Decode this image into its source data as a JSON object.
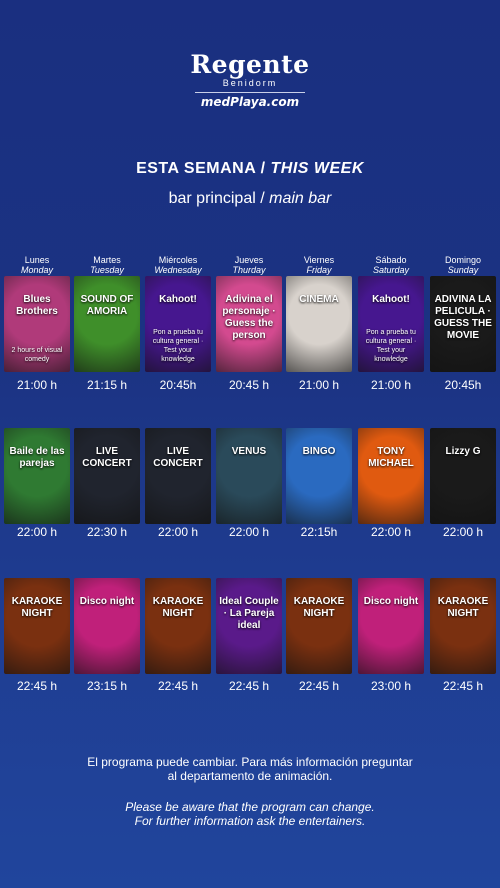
{
  "brand": {
    "name": "Regente",
    "city": "Benidorm",
    "group": "medPlaya.com"
  },
  "heading": {
    "es": "ESTA SEMANA",
    "separator": "/",
    "en": "THIS WEEK"
  },
  "subheading": {
    "es": "bar principal",
    "separator": "/",
    "en": "main bar"
  },
  "days": [
    {
      "es": "Lunes",
      "en": "Monday"
    },
    {
      "es": "Martes",
      "en": "Tuesday"
    },
    {
      "es": "Miércoles",
      "en": "Wednesday"
    },
    {
      "es": "Jueves",
      "en": "Thurday"
    },
    {
      "es": "Viernes",
      "en": "Friday"
    },
    {
      "es": "Sábado",
      "en": "Saturday"
    },
    {
      "es": "Domingo",
      "en": "Sunday"
    }
  ],
  "rows": [
    {
      "events": [
        {
          "name": "Blues Brothers",
          "text": "2 hours of visual comedy",
          "time": "21:00 h",
          "icon": "comedy-poster",
          "color": "#b03a7a"
        },
        {
          "name": "SOUND OF AMORIA",
          "text": "",
          "time": "21:15 h",
          "icon": "music-show-poster",
          "color": "#3f8f2a"
        },
        {
          "name": "Kahoot!",
          "text": "Pon a prueba tu cultura general · Test your knowledge",
          "time": "20:45h",
          "icon": "quiz-poster",
          "color": "#46178f"
        },
        {
          "name": "Adivina el personaje · Guess the person",
          "text": "",
          "time": "20:45 h",
          "icon": "guess-person-poster",
          "color": "#d34a8f"
        },
        {
          "name": "CINEMA",
          "text": "",
          "time": "21:00 h",
          "icon": "cinema-poster",
          "color": "#d8d2cc"
        },
        {
          "name": "Kahoot!",
          "text": "Pon a prueba tu cultura general · Test your knowledge",
          "time": "21:00 h",
          "icon": "quiz-poster",
          "color": "#46178f"
        },
        {
          "name": "ADIVINA LA PELICULA · GUESS THE MOVIE",
          "text": "",
          "time": "20:45h",
          "icon": "film-reel-poster",
          "color": "#1a1a1a"
        }
      ]
    },
    {
      "events": [
        {
          "name": "Baile de las parejas",
          "text": "",
          "time": "22:00 h",
          "icon": "dance-poster",
          "color": "#2f7a32"
        },
        {
          "name": "LIVE CONCERT",
          "text": "",
          "time": "22:30 h",
          "icon": "concert-poster",
          "color": "#20242e"
        },
        {
          "name": "LIVE CONCERT",
          "text": "",
          "time": "22:00 h",
          "icon": "concert-poster",
          "color": "#20242e"
        },
        {
          "name": "VENUS",
          "text": "",
          "time": "22:00 h",
          "icon": "singer-poster",
          "color": "#2a4a5a"
        },
        {
          "name": "BINGO",
          "text": "",
          "time": "22:15h",
          "icon": "bingo-poster",
          "color": "#2a6ac0"
        },
        {
          "name": "TONY MICHAEL",
          "text": "",
          "time": "22:00 h",
          "icon": "singer-poster",
          "color": "#e05a10"
        },
        {
          "name": "Lizzy G",
          "text": "",
          "time": "22:00 h",
          "icon": "singer-poster",
          "color": "#1a1a1a"
        }
      ]
    },
    {
      "events": [
        {
          "name": "KARAOKE NIGHT",
          "text": "",
          "time": "22:45 h",
          "icon": "microphone-poster",
          "color": "#7a3010"
        },
        {
          "name": "Disco night",
          "text": "",
          "time": "23:15 h",
          "icon": "disco-ball-poster",
          "color": "#c0207a"
        },
        {
          "name": "KARAOKE NIGHT",
          "text": "",
          "time": "22:45 h",
          "icon": "microphone-poster",
          "color": "#7a3010"
        },
        {
          "name": "Ideal Couple · La Pareja ideal",
          "text": "",
          "time": "22:45 h",
          "icon": "couple-poster",
          "color": "#5a1a8a"
        },
        {
          "name": "KARAOKE NIGHT",
          "text": "",
          "time": "22:45 h",
          "icon": "microphone-poster",
          "color": "#7a3010"
        },
        {
          "name": "Disco night",
          "text": "",
          "time": "23:00 h",
          "icon": "disco-ball-poster",
          "color": "#c0207a"
        },
        {
          "name": "KARAOKE NIGHT",
          "text": "",
          "time": "22:45 h",
          "icon": "microphone-poster",
          "color": "#7a3010"
        }
      ]
    }
  ],
  "footer": {
    "es_line1": "El programa puede cambiar. Para más información preguntar",
    "es_line2": "al departamento de animación.",
    "en_line1": "Please be aware that the program can change.",
    "en_line2": "For further information ask the entertainers."
  }
}
